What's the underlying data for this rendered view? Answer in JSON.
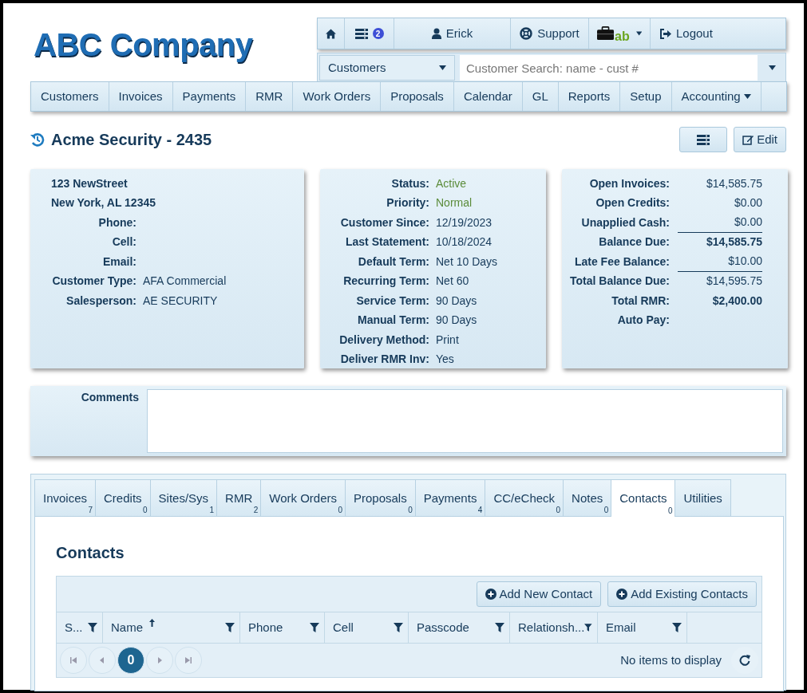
{
  "logo": {
    "text": "ABC Company"
  },
  "toolbar": [
    {
      "kind": "home"
    },
    {
      "kind": "list",
      "badge": "2"
    },
    {
      "kind": "user",
      "label": "Erick"
    },
    {
      "kind": "support",
      "label": "Support"
    },
    {
      "kind": "brand",
      "label": "ab"
    },
    {
      "kind": "logout",
      "label": "Logout"
    }
  ],
  "search": {
    "scope": "Customers",
    "placeholder": "Customer Search: name - cust #"
  },
  "main_nav": [
    {
      "label": "Customers",
      "dropdown": false
    },
    {
      "label": "Invoices",
      "dropdown": false
    },
    {
      "label": "Payments",
      "dropdown": false
    },
    {
      "label": "RMR",
      "dropdown": false
    },
    {
      "label": "Work Orders",
      "dropdown": false
    },
    {
      "label": "Proposals",
      "dropdown": false
    },
    {
      "label": "Calendar",
      "dropdown": false
    },
    {
      "label": "GL",
      "dropdown": false
    },
    {
      "label": "Reports",
      "dropdown": false
    },
    {
      "label": "Setup",
      "dropdown": false
    },
    {
      "label": "Accounting",
      "dropdown": true
    }
  ],
  "customer": {
    "title": "Acme Security - 2435",
    "edit_button": "Edit"
  },
  "address_card": {
    "lines": [
      "123 NewStreet",
      "New York, AL 12345"
    ],
    "fields": [
      {
        "label": "Phone:"
      },
      {
        "label": "Cell:"
      },
      {
        "label": "Email:"
      },
      {
        "label": "Customer Type:",
        "value": "AFA Commercial"
      },
      {
        "label": "Salesperson:",
        "value": "AE SECURITY"
      }
    ]
  },
  "account_card": {
    "fields": [
      {
        "label": "Status:",
        "value": "Active",
        "color": "#5b8c3a"
      },
      {
        "label": "Priority:",
        "value": "Normal",
        "color": "#5b8c3a"
      },
      {
        "label": "Customer Since:",
        "value": "12/19/2023"
      },
      {
        "label": "Last Statement:",
        "value": "10/18/2024"
      },
      {
        "label": "Default Term:",
        "value": "Net 10 Days"
      },
      {
        "label": "Recurring Term:",
        "value": "Net 60"
      },
      {
        "label": "Service Term:",
        "value": "90 Days"
      },
      {
        "label": "Manual Term:",
        "value": "90 Days"
      },
      {
        "label": "Delivery Method:",
        "value": "Print"
      },
      {
        "label": "Deliver RMR Inv:",
        "value": "Yes"
      }
    ]
  },
  "balance_card": {
    "fields": [
      {
        "label": "Open Invoices:",
        "value": "$14,585.75",
        "bold": false,
        "rule_below": false
      },
      {
        "label": "Open Credits:",
        "value": "$0.00",
        "bold": false,
        "rule_below": false
      },
      {
        "label": "Unapplied Cash:",
        "value": "$0.00",
        "bold": false,
        "rule_below": true
      },
      {
        "label": "Balance Due:",
        "value": "$14,585.75",
        "bold": true,
        "rule_below": false
      },
      {
        "label": "Late Fee Balance:",
        "value": "$10.00",
        "bold": false,
        "rule_below": true
      },
      {
        "label": "Total Balance Due:",
        "value": "$14,595.75",
        "bold": false,
        "rule_below": false
      },
      {
        "label": "Total RMR:",
        "value": "$2,400.00",
        "bold": true,
        "rule_below": false
      },
      {
        "label": "Auto Pay:"
      }
    ]
  },
  "comments": {
    "label": "Comments"
  },
  "tabs": [
    {
      "label": "Invoices",
      "count": "7",
      "selected": false
    },
    {
      "label": "Credits",
      "count": "0",
      "selected": false
    },
    {
      "label": "Sites/Sys",
      "count": "1",
      "selected": false
    },
    {
      "label": "RMR",
      "count": "2",
      "selected": false
    },
    {
      "label": "Work Orders",
      "count": "0",
      "selected": false
    },
    {
      "label": "Proposals",
      "count": "0",
      "selected": false
    },
    {
      "label": "Payments",
      "count": "4",
      "selected": false
    },
    {
      "label": "CC/eCheck",
      "count": "0",
      "selected": false
    },
    {
      "label": "Notes",
      "count": "0",
      "selected": false
    },
    {
      "label": "Contacts",
      "count": "0",
      "selected": true
    },
    {
      "label": "Utilities",
      "selected": false
    }
  ],
  "contacts": {
    "heading": "Contacts",
    "buttons": [
      "Add New Contact",
      "Add Existing Contacts"
    ],
    "columns": [
      {
        "label": "S...",
        "sorted": false
      },
      {
        "label": "Name",
        "sorted": true
      },
      {
        "label": "Phone",
        "sorted": false
      },
      {
        "label": "Cell",
        "sorted": false
      },
      {
        "label": "Passcode",
        "sorted": false
      },
      {
        "label": "Relationsh...",
        "sorted": false
      },
      {
        "label": "Email",
        "sorted": false
      }
    ],
    "pager": {
      "current_page": "0",
      "status": "No items to display"
    }
  }
}
